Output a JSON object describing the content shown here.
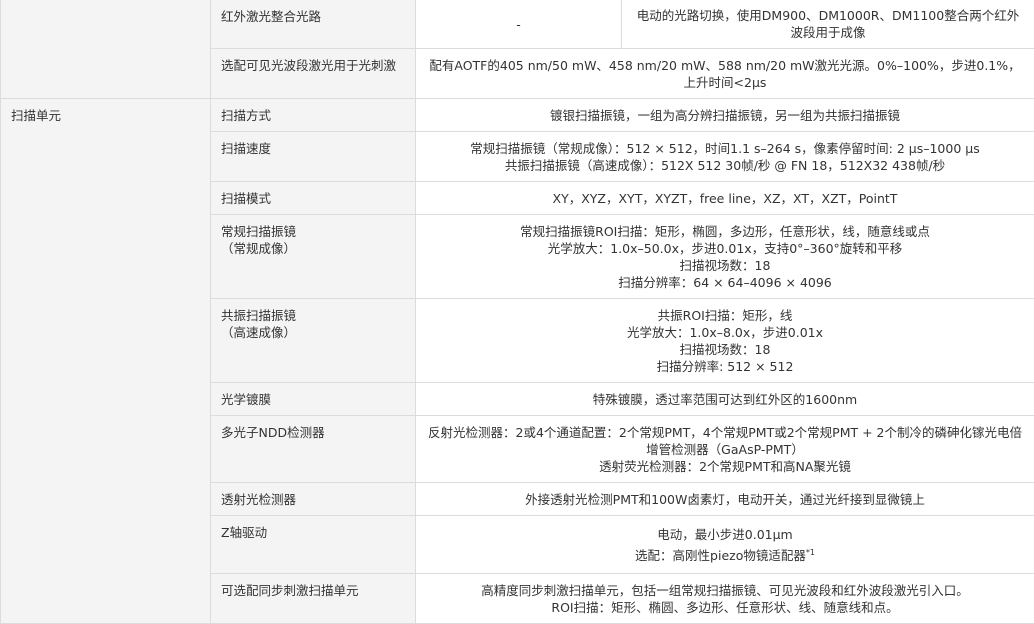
{
  "rows": {
    "ir_path": {
      "label": "红外激光整合光路",
      "col1": "-",
      "col2": "电动的光路切换，使用DM900、DM1000R、DM1100整合两个红外波段用于成像"
    },
    "vis_laser": {
      "label": "选配可见光波段激光用于光刺激",
      "value": "配有AOTF的405 nm/50 mW、458 nm/20 mW、588 nm/20 mW激光光源。0%–100%，步进0.1%，上升时间<2µs"
    }
  },
  "scan_unit": {
    "category": "扫描单元",
    "scan_method": {
      "label": "扫描方式",
      "value": "镀银扫描振镜，一组为高分辨扫描振镜，另一组为共振扫描振镜"
    },
    "scan_speed": {
      "label": "扫描速度",
      "lines": [
        "常规扫描振镜（常规成像）：512 × 512，时间1.1 s–264 s，像素停留时间: 2 µs–1000 µs",
        "共振扫描振镜（高速成像）：512X 512 30帧/秒 @ FN 18，512X32 438帧/秒"
      ]
    },
    "scan_mode": {
      "label": "扫描模式",
      "value": "XY，XYZ，XYT，XYZT，free line，XZ，XT，XZT，PointT"
    },
    "galvo": {
      "label_lines": [
        "常规扫描振镜",
        "（常规成像）"
      ],
      "lines": [
        "常规扫描振镜ROI扫描：矩形，椭圆，多边形，任意形状，线，随意线或点",
        "光学放大：1.0x–50.0x，步进0.01x，支持0°–360°旋转和平移",
        "扫描视场数：18",
        "扫描分辨率：64 × 64–4096 × 4096"
      ]
    },
    "resonant": {
      "label_lines": [
        "共振扫描振镜",
        "（高速成像）"
      ],
      "lines": [
        "共振ROI扫描：矩形，线",
        "光学放大：1.0x–8.0x，步进0.01x",
        "扫描视场数：18",
        "扫描分辨率: 512 × 512"
      ]
    },
    "coating": {
      "label": "光学镀膜",
      "value": "特殊镀膜，透过率范围可达到红外区的1600nm"
    },
    "ndd": {
      "label": "多光子NDD检测器",
      "lines": [
        "反射光检测器：2或4个通道配置：2个常规PMT，4个常规PMT或2个常规PMT + 2个制冷的磷砷化镓光电倍增管检测器（GaAsP-PMT）",
        "透射荧光检测器：2个常规PMT和高NA聚光镜"
      ]
    },
    "trans_detector": {
      "label": "透射光检测器",
      "value": "外接透射光检测PMT和100W卤素灯，电动开关，通过光纤接到显微镜上"
    },
    "z_drive": {
      "label": "Z轴驱动",
      "line1": "电动，最小步进0.01µm",
      "line2": "选配：高刚性piezo物镜适配器",
      "note": "*1"
    },
    "sync_unit": {
      "label": "可选配同步刺激扫描单元",
      "lines": [
        "高精度同步刺激扫描单元，包括一组常规扫描振镜、可见光波段和红外波段激光引入口。",
        "ROI扫描：矩形、椭圆、多边形、任意形状、线、随意线和点。"
      ]
    }
  }
}
